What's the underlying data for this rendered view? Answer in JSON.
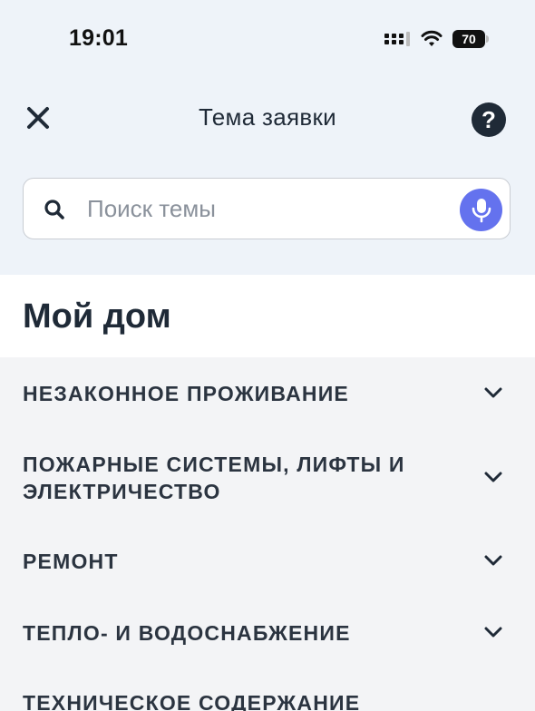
{
  "status_bar": {
    "time": "19:01",
    "battery": "70"
  },
  "header": {
    "title": "Тема заявки",
    "help_label": "?"
  },
  "search": {
    "placeholder": "Поиск темы"
  },
  "section": {
    "title": "Мой дом"
  },
  "topics": [
    {
      "label": "НЕЗАКОННОЕ ПРОЖИВАНИЕ"
    },
    {
      "label": "ПОЖАРНЫЕ СИСТЕМЫ, ЛИФТЫ И ЭЛЕКТРИЧЕСТВО"
    },
    {
      "label": "РЕМОНТ"
    },
    {
      "label": "ТЕПЛО- И ВОДОСНАБЖЕНИЕ"
    },
    {
      "label": "ТЕХНИЧЕСКОЕ СОДЕРЖАНИЕ"
    }
  ],
  "colors": {
    "header_bg": "#eef3f9",
    "list_bg": "#f3f4f6",
    "accent_mic": "#6472ee",
    "text_dark": "#1f2a37"
  },
  "icons": {
    "close": "close-icon",
    "help": "help-icon",
    "search": "search-icon",
    "mic": "microphone-icon",
    "expand": "chevron-down-icon"
  }
}
